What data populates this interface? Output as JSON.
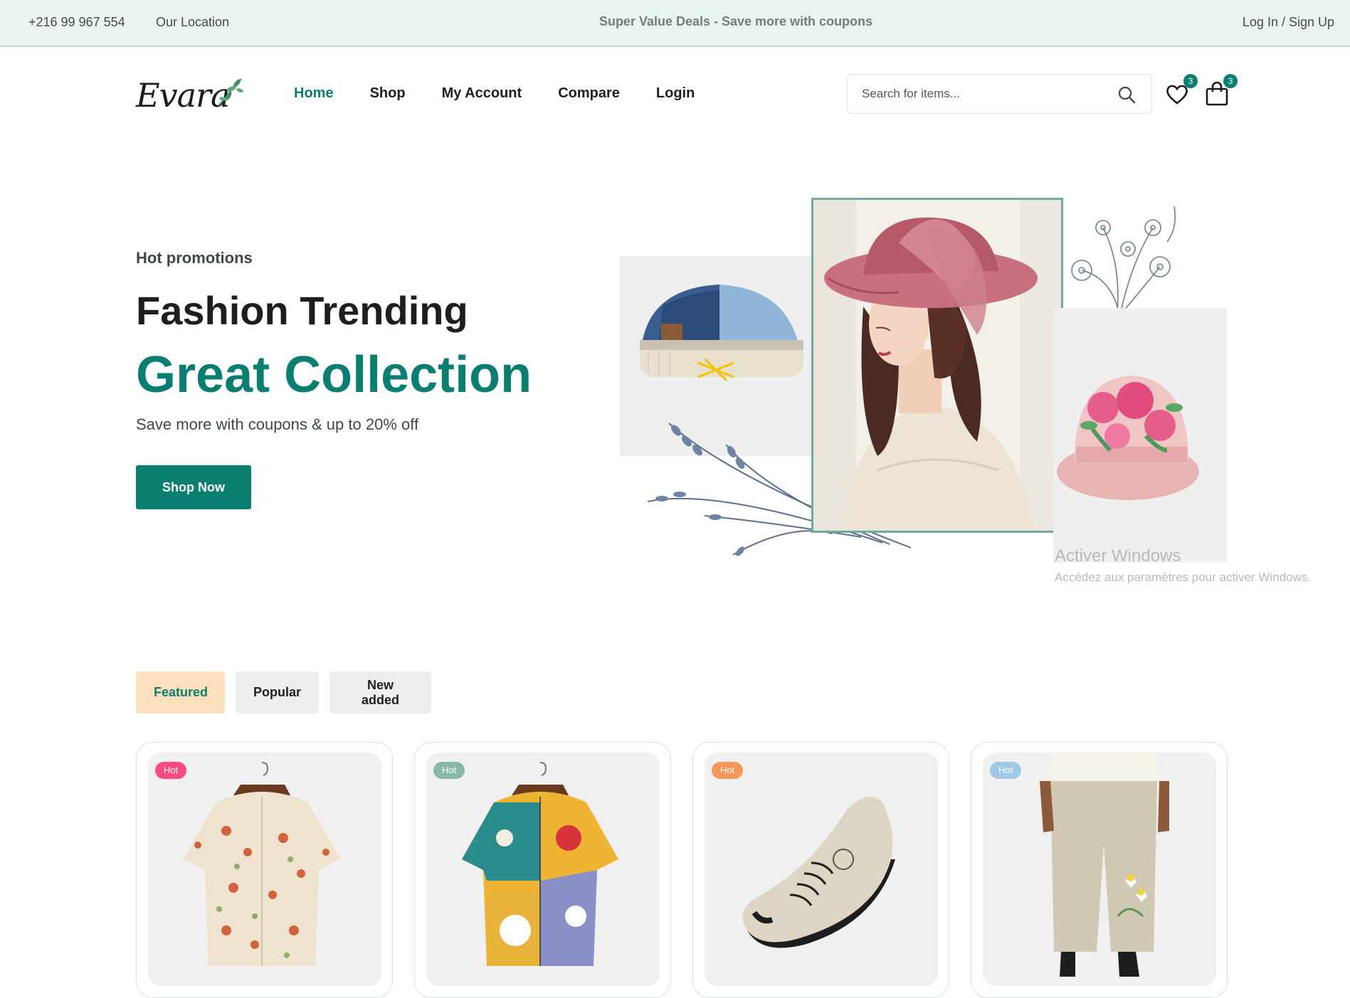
{
  "topbar": {
    "phone": "+216 99 967 554",
    "location": "Our Location",
    "deal": "Super Value Deals - Save more with coupons",
    "login": "Log In / Sign Up"
  },
  "header": {
    "logo": "Evara",
    "nav": [
      "Home",
      "Shop",
      "My Account",
      "Compare",
      "Login"
    ],
    "active_nav": "Home",
    "search_placeholder": "Search for items...",
    "wishlist_count": "3",
    "cart_count": "3"
  },
  "hero": {
    "subtitle": "Hot promotions",
    "title_1": "Fashion Trending",
    "title_2": "Great Collection",
    "description": "Save more with coupons & up to 20% off",
    "button": "Shop Now"
  },
  "windows_notice": {
    "title": "Activer Windows",
    "subtitle": "Accédez aux paramètres pour activer Windows."
  },
  "tabs": [
    "Featured",
    "Popular",
    "New added"
  ],
  "active_tab": "Featured",
  "products": [
    {
      "badge": "Hot",
      "badge_color": "#f74b81",
      "image": "mushroom-print-shirt"
    },
    {
      "badge": "Hot",
      "badge_color": "#88b9a4",
      "image": "colorful-floral-shirt"
    },
    {
      "badge": "Hot",
      "badge_color": "#f59758",
      "image": "beige-sneaker"
    },
    {
      "badge": "Hot",
      "badge_color": "#9fc9e6",
      "image": "linen-pants"
    }
  ],
  "colors": {
    "accent": "#0b7e72",
    "topbar_bg": "#e9f4ee",
    "active_tab_bg": "#fce0be"
  }
}
